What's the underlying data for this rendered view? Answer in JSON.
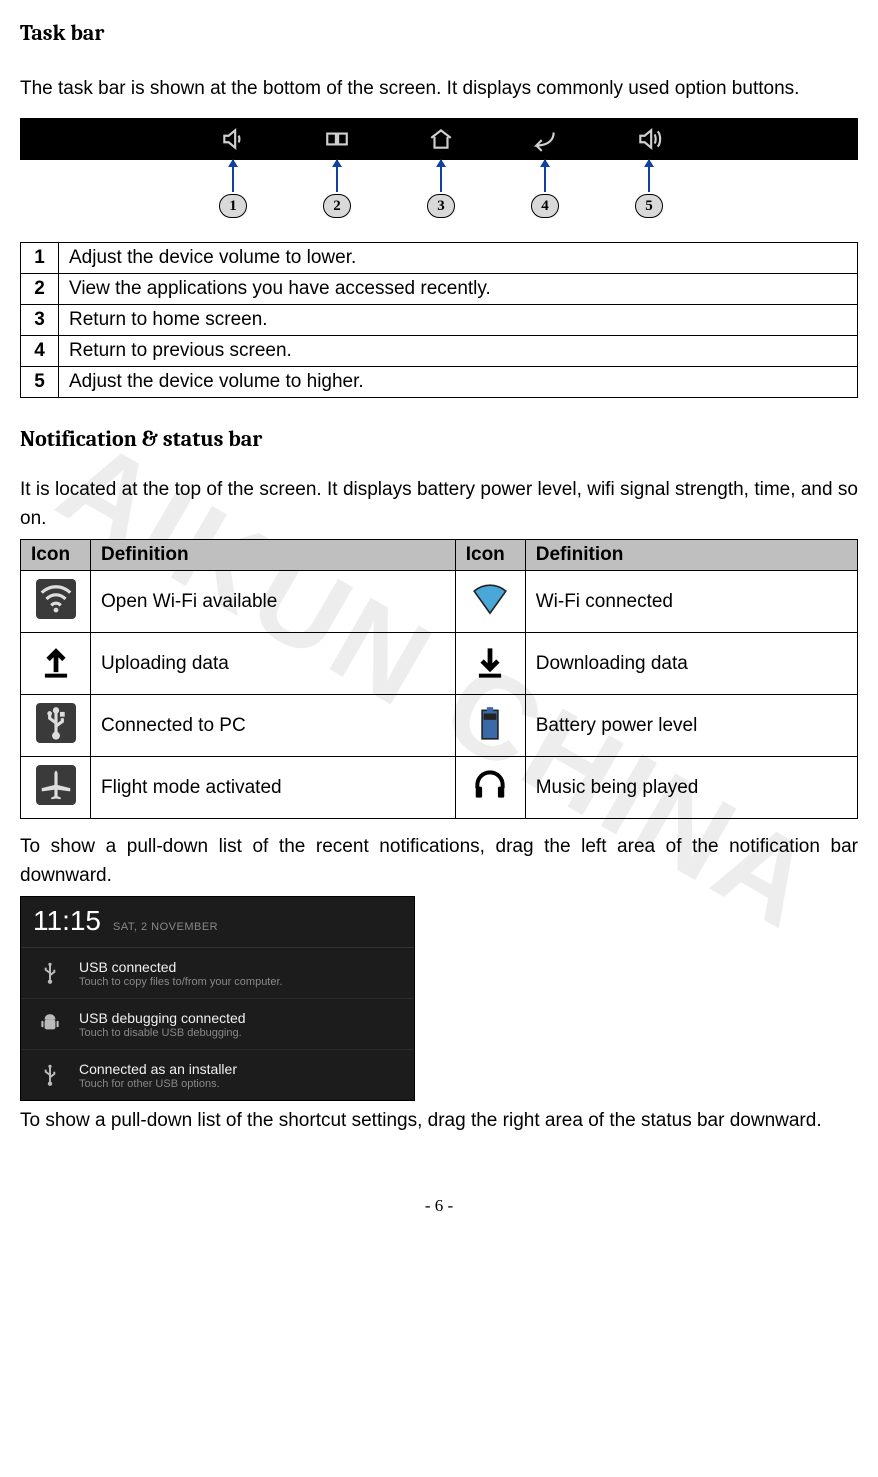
{
  "watermark": "AIKUN CHINA",
  "section1": {
    "title": "Task bar",
    "intro": "The task bar is shown at the bottom of the screen. It displays commonly used option buttons.",
    "labels": [
      "1",
      "2",
      "3",
      "4",
      "5"
    ],
    "legend": [
      {
        "n": "1",
        "d": "Adjust the device volume to lower."
      },
      {
        "n": "2",
        "d": "View the applications you have accessed recently."
      },
      {
        "n": "3",
        "d": "Return to home screen."
      },
      {
        "n": "4",
        "d": "Return to previous screen."
      },
      {
        "n": "5",
        "d": "Adjust the device volume to higher."
      }
    ]
  },
  "section2": {
    "title": "Notification & status bar",
    "intro": "It is located at the top of the screen. It displays battery power level, wifi signal strength, time, and so on.",
    "headers": {
      "icon": "Icon",
      "def": "Definition"
    },
    "rows": [
      {
        "l_icon": "wifi-open",
        "l_def": "Open Wi-Fi available",
        "r_icon": "wifi-connected",
        "r_def": "Wi-Fi connected"
      },
      {
        "l_icon": "upload",
        "l_def": "Uploading data",
        "r_icon": "download",
        "r_def": "Downloading data"
      },
      {
        "l_icon": "usb",
        "l_def": "Connected to PC",
        "r_icon": "battery",
        "r_def": "Battery power level"
      },
      {
        "l_icon": "airplane",
        "l_def": "Flight mode activated",
        "r_icon": "headphones",
        "r_def": "Music being played"
      }
    ],
    "after1": "To show a pull-down list of the recent notifications, drag the left area of the notification bar downward.",
    "panel": {
      "time": "11:15",
      "date": "SAT, 2 NOVEMBER",
      "items": [
        {
          "icon": "usb",
          "t1": "USB connected",
          "t2": "Touch to copy files to/from your computer."
        },
        {
          "icon": "android",
          "t1": "USB debugging connected",
          "t2": "Touch to disable USB debugging."
        },
        {
          "icon": "usb",
          "t1": "Connected as an installer",
          "t2": "Touch for other USB options."
        }
      ]
    },
    "after2": "To show a pull-down list of the shortcut settings, drag the right area of the status bar downward."
  },
  "footer": "- 6 -"
}
